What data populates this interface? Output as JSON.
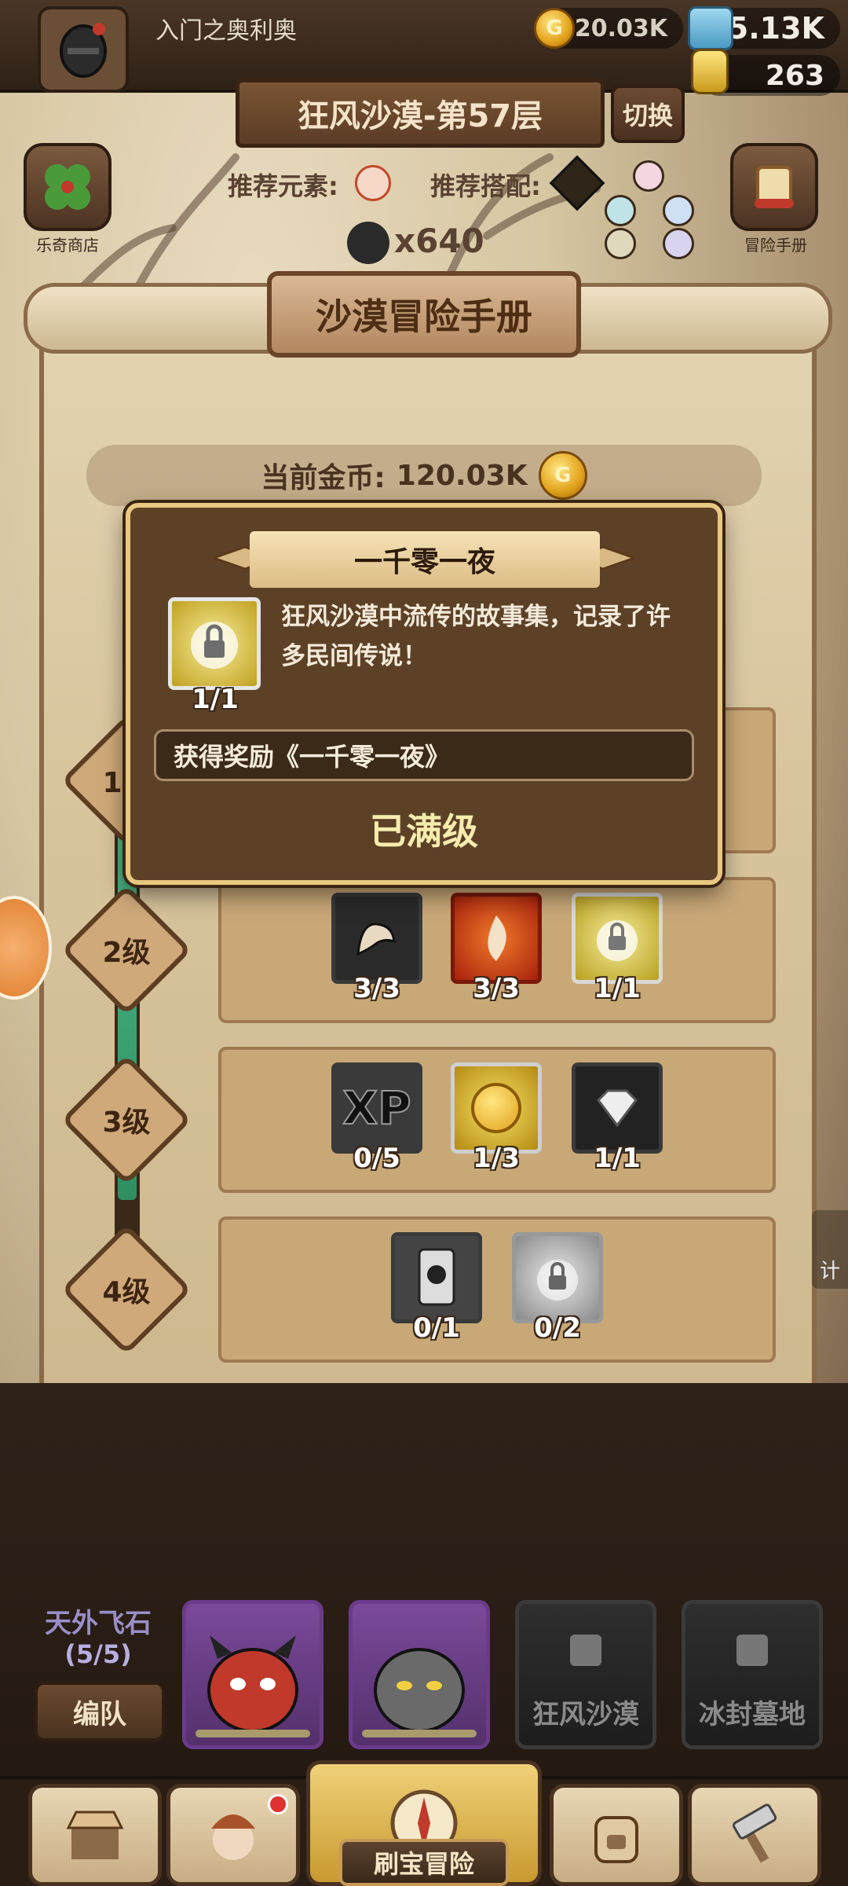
{
  "player": {
    "name": "入门之奥利奥"
  },
  "resources": {
    "coins": "120.03K",
    "gems": "5.13K",
    "potions": "263"
  },
  "stage": {
    "title": "狂风沙漠-第57层",
    "switch_label": "切换",
    "recommend_element_label": "推荐元素:",
    "recommend_combo_label": "推荐搭配:",
    "skull_count": "x640"
  },
  "side_buttons": {
    "shop_label": "乐奇商店",
    "handbook_label": "冒险手册"
  },
  "handbook": {
    "title": "沙漠冒险手册",
    "current_gold_label": "当前金币:",
    "current_gold_value": "120.03K",
    "levels": [
      {
        "label": "1级",
        "items": []
      },
      {
        "label": "2级",
        "items": [
          {
            "icon": "muscle-arm-icon",
            "count": "3/3"
          },
          {
            "icon": "fire-element-icon",
            "count": "3/3"
          },
          {
            "icon": "locked-book-icon",
            "count": "1/1"
          }
        ]
      },
      {
        "label": "3级",
        "items": [
          {
            "icon": "xp-icon",
            "count": "0/5"
          },
          {
            "icon": "gold-coin-icon",
            "count": "1/3"
          },
          {
            "icon": "diamond-icon",
            "count": "1/1"
          }
        ]
      },
      {
        "label": "4级",
        "items": [
          {
            "icon": "card-icon",
            "count": "0/1"
          },
          {
            "icon": "locked-book-gray-icon",
            "count": "0/2"
          }
        ]
      }
    ],
    "progress_fraction": 0.92
  },
  "popup": {
    "title": "一千零一夜",
    "item_count": "1/1",
    "description": "狂风沙漠中流传的故事集，记录了许多民间传说！",
    "reward": "获得奖励《一千零一夜》",
    "status": "已满级"
  },
  "team": {
    "name": "天外飞石",
    "count": "(5/5)",
    "formation_label": "编队",
    "locked_areas": [
      "狂风沙漠",
      "冰封墓地"
    ]
  },
  "nav": {
    "active_label": "刷宝冒险"
  },
  "side_right_label": "计",
  "colors": {
    "popup_border": "#e8c880",
    "progress_green": "#4fbe8c",
    "popup_status": "#f6ecae"
  }
}
